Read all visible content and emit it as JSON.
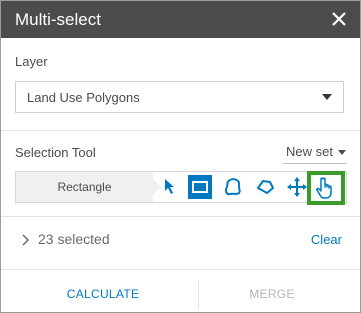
{
  "window": {
    "title": "Multi-select"
  },
  "layer": {
    "label": "Layer",
    "selected": "Land Use Polygons"
  },
  "selection_tool": {
    "label": "Selection Tool",
    "mode": "New set",
    "active_tool_name": "Rectangle",
    "tools": [
      {
        "icon": "select-cursor-icon",
        "active": false
      },
      {
        "icon": "rectangle-icon",
        "active": true
      },
      {
        "icon": "lasso-icon",
        "active": false
      },
      {
        "icon": "polygon-icon",
        "active": false
      },
      {
        "icon": "pan-icon",
        "active": false
      },
      {
        "icon": "hand-pointer-icon",
        "active": false,
        "highlighted": true
      }
    ]
  },
  "selection": {
    "count_text": "23 selected",
    "clear_label": "Clear"
  },
  "footer": {
    "calculate_label": "CALCULATE",
    "merge_label": "MERGE"
  },
  "colors": {
    "titlebar": "#4c4c4c",
    "accent": "#0079c1",
    "highlight": "#3a9a2a",
    "disabled": "#b5b5b5"
  }
}
